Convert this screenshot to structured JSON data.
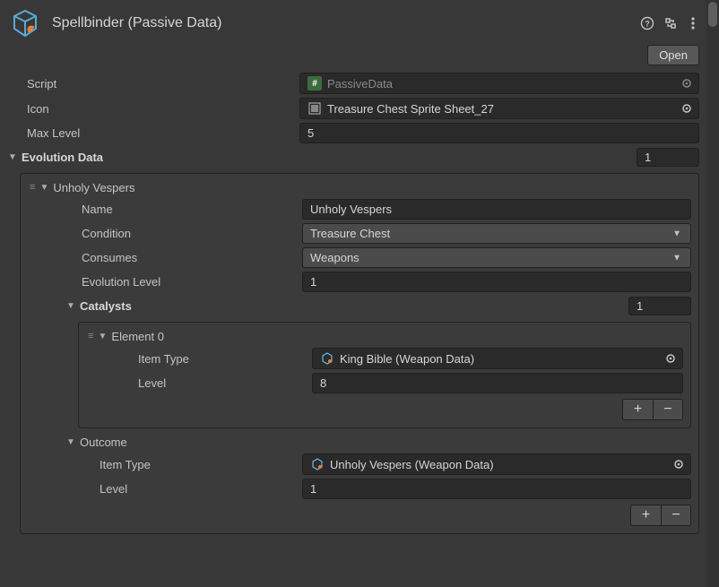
{
  "header": {
    "title": "Spellbinder (Passive Data)",
    "open_label": "Open"
  },
  "fields": {
    "script_label": "Script",
    "script_value": "PassiveData",
    "icon_label": "Icon",
    "icon_value": "Treasure Chest Sprite Sheet_27",
    "maxlevel_label": "Max Level",
    "maxlevel_value": "5"
  },
  "evolution": {
    "label": "Evolution Data",
    "count": "1",
    "item": {
      "title": "Unholy Vespers",
      "name_label": "Name",
      "name_value": "Unholy Vespers",
      "condition_label": "Condition",
      "condition_value": "Treasure Chest",
      "consumes_label": "Consumes",
      "consumes_value": "Weapons",
      "evolevel_label": "Evolution Level",
      "evolevel_value": "1",
      "catalysts": {
        "label": "Catalysts",
        "count": "1",
        "element": {
          "title": "Element 0",
          "itemtype_label": "Item Type",
          "itemtype_value": "King Bible (Weapon Data)",
          "level_label": "Level",
          "level_value": "8"
        }
      },
      "outcome": {
        "label": "Outcome",
        "itemtype_label": "Item Type",
        "itemtype_value": "Unholy Vespers (Weapon Data)",
        "level_label": "Level",
        "level_value": "1"
      }
    }
  }
}
